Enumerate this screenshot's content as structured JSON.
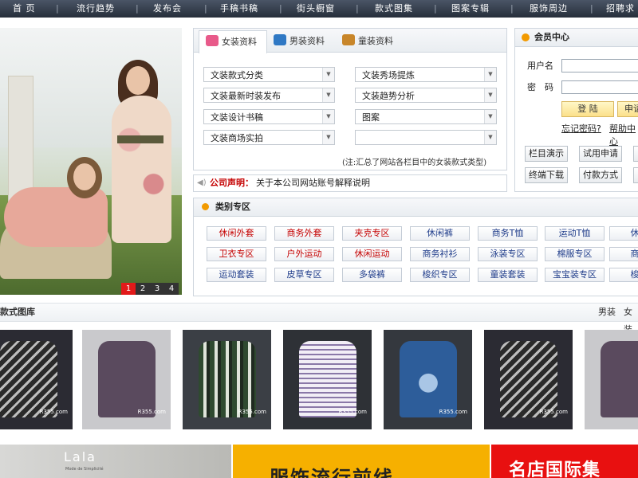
{
  "nav": {
    "items": [
      "首 页",
      "流行趋势",
      "发布会",
      "手稿书稿",
      "街头橱窗",
      "款式图集",
      "图案专辑",
      "服饰周边",
      "招聘求"
    ]
  },
  "hero": {
    "pager": [
      "1",
      "2",
      "3",
      "4"
    ],
    "active_page": "1"
  },
  "tabs": [
    {
      "label": "女装资料",
      "color": "#e85a8a"
    },
    {
      "label": "男装资料",
      "color": "#2f78c4"
    },
    {
      "label": "童装资料",
      "color": "#c8862a"
    }
  ],
  "selects": [
    "文装款式分类",
    "文装秀场提炼",
    "文装最新时装发布",
    "文装趋势分析",
    "文装设计书稿",
    "图案",
    "文装商场实拍",
    ""
  ],
  "note": "(注:汇总了网站各栏目中的女装款式类型)",
  "notice": {
    "label": "公司声明：",
    "text": "关于本公司网站账号解释说明"
  },
  "member": {
    "title": "会员中心",
    "username_label": "用户名",
    "password_label": "密　码",
    "login_label": "登 陆",
    "register_label": "申请",
    "forgot_label": "忘记密码?",
    "help_label": "帮助中心",
    "buttons": [
      "栏目演示",
      "试用申请",
      "终端下载",
      "付款方式"
    ]
  },
  "categories": {
    "title": "类别专区",
    "rows": [
      [
        {
          "t": "休闲外套",
          "c": "r"
        },
        {
          "t": "商务外套",
          "c": "r"
        },
        {
          "t": "夹克专区",
          "c": "r"
        },
        {
          "t": "休闲裤",
          "c": "b"
        },
        {
          "t": "商务T恤",
          "c": "b"
        },
        {
          "t": "运动T恤",
          "c": "b"
        },
        {
          "t": "休闲",
          "c": "b"
        }
      ],
      [
        {
          "t": "卫衣专区",
          "c": "r"
        },
        {
          "t": "户外运动",
          "c": "r"
        },
        {
          "t": "休闲运动",
          "c": "r"
        },
        {
          "t": "商务衬衫",
          "c": "b"
        },
        {
          "t": "泳装专区",
          "c": "b"
        },
        {
          "t": "棉服专区",
          "c": "b"
        },
        {
          "t": "商务",
          "c": "b"
        }
      ],
      [
        {
          "t": "运动套装",
          "c": "b"
        },
        {
          "t": "皮草专区",
          "c": "b"
        },
        {
          "t": "多袋裤",
          "c": "b"
        },
        {
          "t": "梭织专区",
          "c": "b"
        },
        {
          "t": "童装套装",
          "c": "b"
        },
        {
          "t": "宝宝装专区",
          "c": "b"
        },
        {
          "t": "梭织",
          "c": "b"
        }
      ]
    ]
  },
  "gallery": {
    "title": "款式图库",
    "links": [
      "男装",
      "女装"
    ],
    "watermark": "R355.com"
  },
  "banners": {
    "left_brand": "Lala",
    "left_sub": "Mode de Simplicité",
    "middle": "服饰流行前线",
    "right": "名店国际集"
  }
}
